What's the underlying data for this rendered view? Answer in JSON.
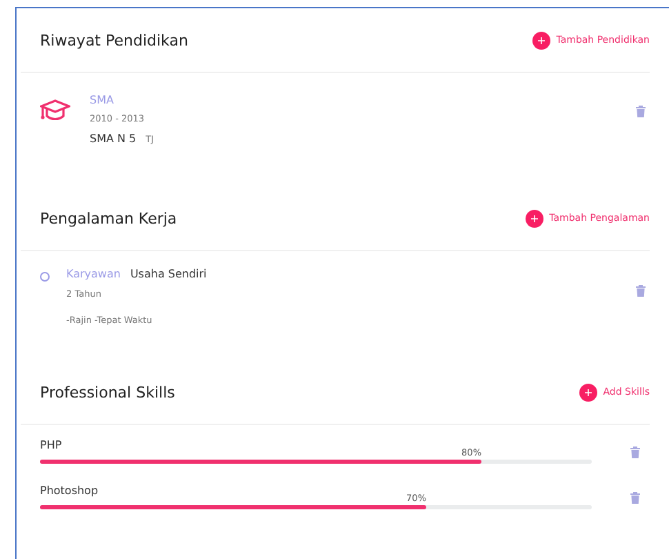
{
  "education": {
    "title": "Riwayat Pendidikan",
    "add_label": "Tambah Pendidikan",
    "items": [
      {
        "level": "SMA",
        "years": "2010 - 2013",
        "school": "SMA N 5",
        "city": "TJ"
      }
    ]
  },
  "experience": {
    "title": "Pengalaman Kerja",
    "add_label": "Tambah Pengalaman",
    "items": [
      {
        "position": "Karyawan",
        "company": "Usaha Sendiri",
        "duration": "2 Tahun",
        "notes": "-Rajin -Tepat Waktu"
      }
    ]
  },
  "skills": {
    "title": "Professional Skills",
    "add_label": "Add Skills",
    "items": [
      {
        "name": "PHP",
        "level": 0.8,
        "reading": "80%"
      },
      {
        "name": "Photoshop",
        "level": 0.7,
        "reading": "70%"
      }
    ]
  }
}
